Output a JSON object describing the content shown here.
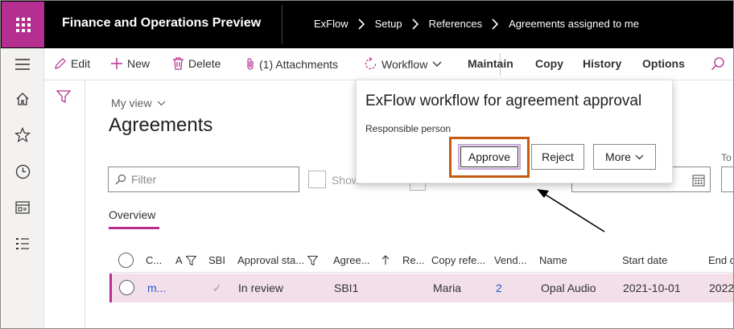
{
  "app": {
    "title": "Finance and Operations Preview",
    "breadcrumbs": [
      "ExFlow",
      "Setup",
      "References",
      "Agreements assigned to me"
    ]
  },
  "actions": {
    "edit": "Edit",
    "new": "New",
    "delete": "Delete",
    "attachments": "(1) Attachments",
    "workflow": "Workflow",
    "maintain": "Maintain",
    "copy": "Copy",
    "history": "History",
    "options": "Options"
  },
  "page": {
    "view_selector": "My view",
    "title": "Agreements",
    "filter_placeholder": "Filter",
    "show_label": "Show",
    "to_label": "To",
    "tab_overview": "Overview"
  },
  "grid": {
    "columns": [
      "C...",
      "A",
      "SBI",
      "Approval sta...",
      "Agree...",
      "Re...",
      "Copy refe...",
      "Vend...",
      "Name",
      "Start date",
      "End d"
    ],
    "rows": [
      {
        "c": "m...",
        "sbi_check": "✓",
        "approval_status": "In review",
        "agreement": "SBI1",
        "copy_reference": "Maria",
        "vendor": "2",
        "name": "Opal Audio",
        "start_date": "2021-10-01",
        "end_date": "2022"
      }
    ]
  },
  "popup": {
    "title": "ExFlow workflow for agreement approval",
    "subtitle": "Responsible person",
    "approve": "Approve",
    "reject": "Reject",
    "more": "More"
  },
  "colors": {
    "brand": "#b52f91",
    "selected_row": "#f2dfea",
    "highlight": "#c55a11",
    "link": "#2557d6"
  }
}
